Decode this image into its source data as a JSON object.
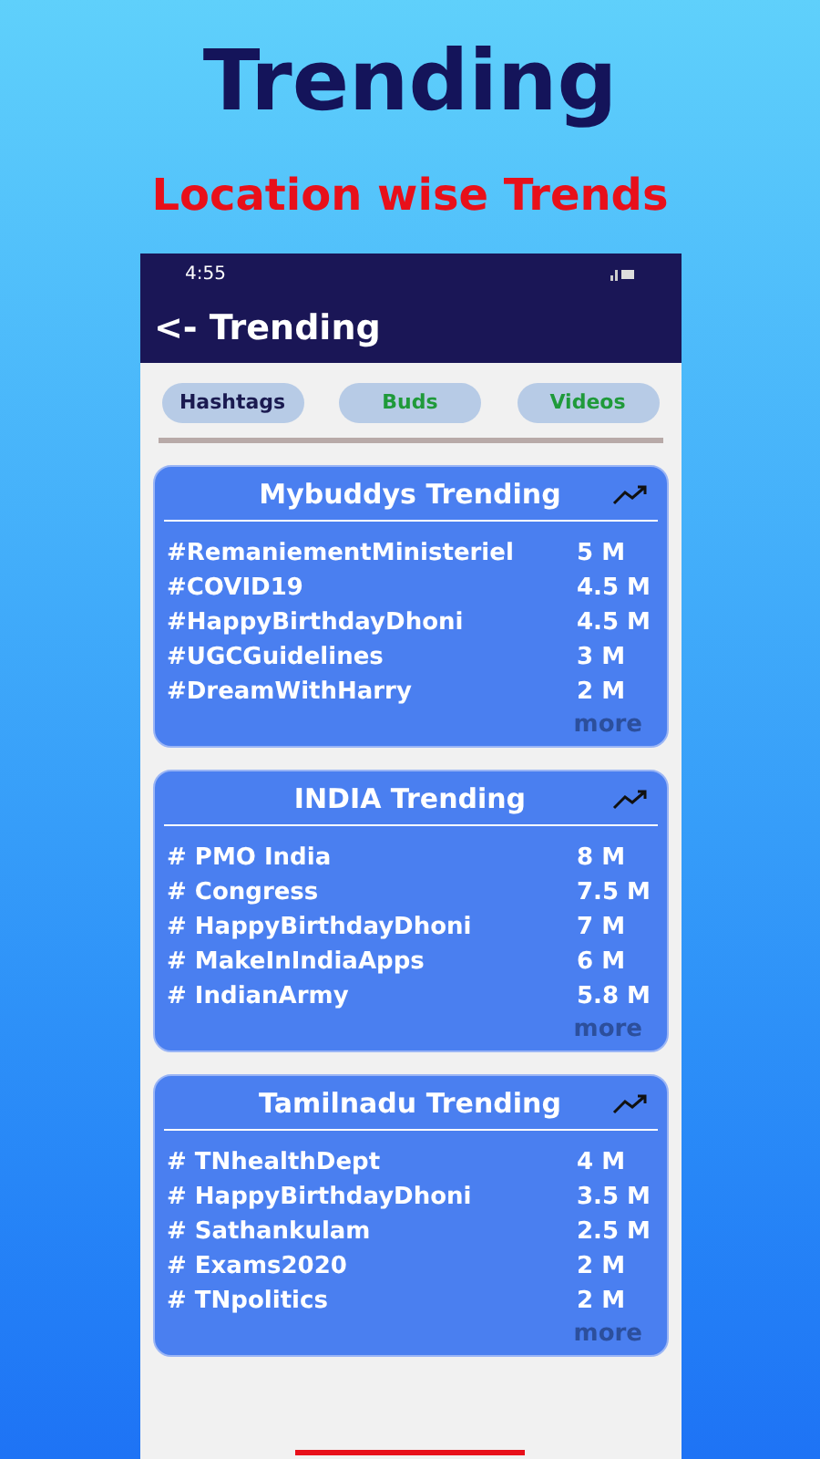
{
  "headline": "Trending",
  "subtitle": "Location wise Trends",
  "status_bar": {
    "time": "4:55"
  },
  "app_bar": {
    "title": "<- Trending"
  },
  "tabs": [
    {
      "label": "Hashtags",
      "selected": true
    },
    {
      "label": "Buds",
      "selected": false
    },
    {
      "label": "Videos",
      "selected": false
    }
  ],
  "cards": [
    {
      "title": "Mybuddys Trending",
      "more": "more",
      "rows": [
        {
          "tag": "#RemaniementMinisteriel",
          "count": "5 M"
        },
        {
          "tag": "#COVID19",
          "count": "4.5 M"
        },
        {
          "tag": "#HappyBirthdayDhoni",
          "count": "4.5 M"
        },
        {
          "tag": "#UGCGuidelines",
          "count": "3 M"
        },
        {
          "tag": "#DreamWithHarry",
          "count": "2 M"
        }
      ]
    },
    {
      "title": "INDIA Trending",
      "more": "more",
      "rows": [
        {
          "tag": "# PMO India",
          "count": "8 M"
        },
        {
          "tag": "# Congress",
          "count": "7.5 M"
        },
        {
          "tag": "# HappyBirthdayDhoni",
          "count": "7 M"
        },
        {
          "tag": "# MakeInIndiaApps",
          "count": "6 M"
        },
        {
          "tag": "# IndianArmy",
          "count": "5.8 M"
        }
      ]
    },
    {
      "title": "Tamilnadu Trending",
      "more": "more",
      "rows": [
        {
          "tag": "# TNhealthDept",
          "count": "4 M"
        },
        {
          "tag": "# HappyBirthdayDhoni",
          "count": "3.5 M"
        },
        {
          "tag": "# Sathankulam",
          "count": "2.5 M"
        },
        {
          "tag": "# Exams2020",
          "count": "2 M"
        },
        {
          "tag": "# TNpolitics",
          "count": "2 M"
        }
      ]
    }
  ]
}
